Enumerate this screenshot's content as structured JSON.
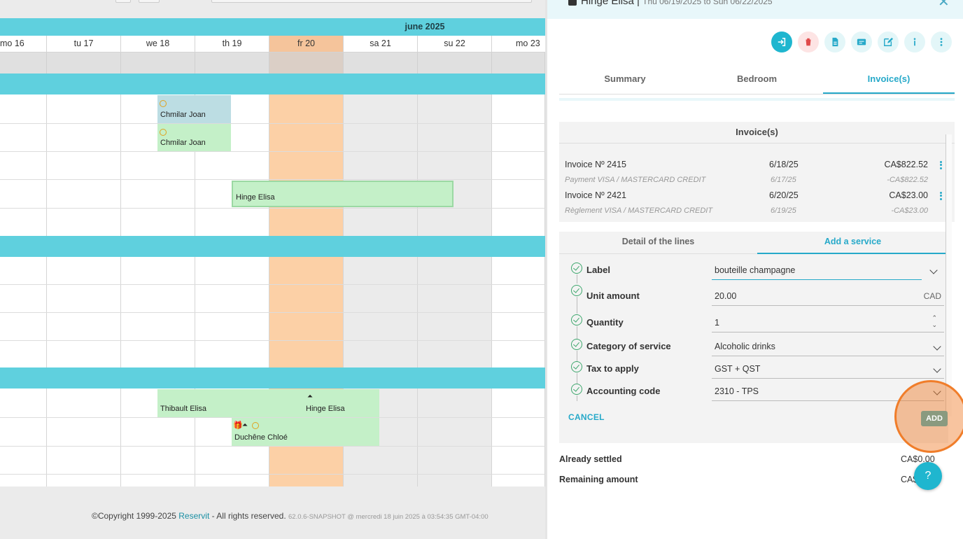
{
  "planning": {
    "month_label": "june 2025",
    "days": [
      {
        "label": "mo 16",
        "kind": "white"
      },
      {
        "label": "tu 17",
        "kind": "white"
      },
      {
        "label": "we 18",
        "kind": "white"
      },
      {
        "label": "th 19",
        "kind": "white"
      },
      {
        "label": "fr 20",
        "kind": "today"
      },
      {
        "label": "sa 21",
        "kind": "we"
      },
      {
        "label": "su 22",
        "kind": "we"
      },
      {
        "label": "mo 23",
        "kind": "white"
      }
    ],
    "bookings": [
      {
        "name": "Chmilar Joan",
        "color": "#bcdde3"
      },
      {
        "name": "Chmilar Joan",
        "color": "#c4f0c8"
      },
      {
        "name": "Hinge Elisa",
        "color": "#c4f0c8"
      },
      {
        "name": "Thibault Elisa",
        "color": "#c4f0c8"
      },
      {
        "name": "Hinge Elisa",
        "color": "#c4f0c8"
      },
      {
        "name": "Duchêne Chloé",
        "color": "#c4f0c8"
      }
    ],
    "footer": {
      "copyright": "©Copyright 1999-2025 ",
      "brand": "Reservit",
      "rights": " - All rights reserved. ",
      "version": "62.0.6-SNAPSHOT @ mercredi 18 juin 2025 à 03:54:35 GMT-04:00"
    }
  },
  "panel": {
    "guest": "Hinge Elisa",
    "dates": "Thu 06/19/2025 to Sun 06/22/2025",
    "tabs": [
      "Summary",
      "Bedroom",
      "Invoice(s)"
    ],
    "active_tab": "Invoice(s)",
    "invoices_title": "Invoice(s)",
    "invoices": [
      {
        "label": "Invoice Nº 2415",
        "date": "6/18/25",
        "amount": "CA$822.52",
        "payment": {
          "label": "Payment VISA / MASTERCARD CREDIT",
          "date": "6/17/25",
          "amount": "-CA$822.52"
        }
      },
      {
        "label": "Invoice Nº 2421",
        "date": "6/20/25",
        "amount": "CA$23.00",
        "payment": {
          "label": "Règlement VISA / MASTERCARD CREDIT",
          "date": "6/19/25",
          "amount": "-CA$23.00"
        }
      }
    ],
    "subtabs": [
      "Detail of the lines",
      "Add a service"
    ],
    "active_subtab": "Add a service",
    "form": {
      "label": {
        "label": "Label",
        "value": "bouteille champagne"
      },
      "unit_amount": {
        "label": "Unit amount",
        "value": "20.00",
        "unit": "CAD"
      },
      "quantity": {
        "label": "Quantity",
        "value": "1"
      },
      "category": {
        "label": "Category of service",
        "value": "Alcoholic drinks"
      },
      "tax": {
        "label": "Tax to apply",
        "value": "GST + QST"
      },
      "accounting": {
        "label": "Accounting code",
        "value": "2310 - TPS"
      }
    },
    "cancel_label": "CANCEL",
    "add_label": "ADD",
    "already_settled_label": "Already settled",
    "already_settled_value": "CA$0.00",
    "remaining_label": "Remaining amount",
    "remaining_value": "CA$",
    "help_label": "?",
    "colors": {
      "accent": "#26a9c9",
      "highlight": "#f07d2a",
      "today": "#fcd0a6",
      "group": "#5fd0de"
    }
  }
}
